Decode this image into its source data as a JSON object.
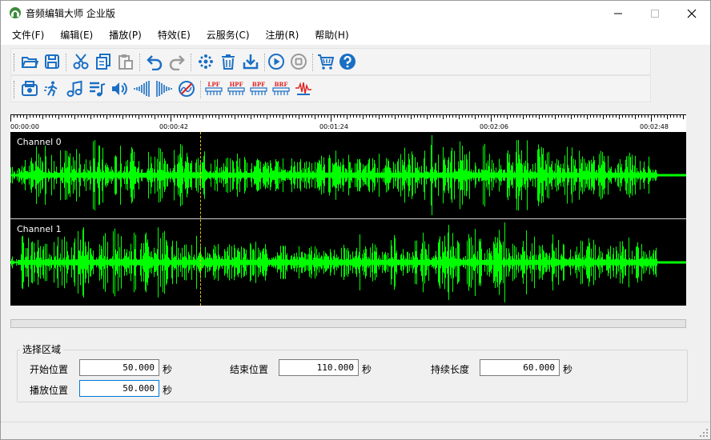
{
  "window": {
    "title": "音频编辑大师 企业版"
  },
  "menu": [
    "文件(F)",
    "编辑(E)",
    "播放(P)",
    "特效(E)",
    "云服务(C)",
    "注册(R)",
    "帮助(H)"
  ],
  "toolbar1": [
    "open-icon",
    "save-icon",
    "cut-icon",
    "copy-icon",
    "paste-icon",
    "undo-icon",
    "redo-icon",
    "effects-icon",
    "delete-icon",
    "download-icon",
    "play-icon",
    "stop-icon",
    "cart-icon",
    "help-icon"
  ],
  "toolbar2": [
    "stereo-icon",
    "walk-icon",
    "music-note-icon",
    "playlist-icon",
    "volume-icon",
    "fade-in-icon",
    "fade-out-icon",
    "mute-icon",
    "lpf-icon",
    "hpf-icon",
    "bpf-icon",
    "brf-icon",
    "waveform-icon"
  ],
  "filters": [
    "LPF",
    "HPF",
    "BPF",
    "BRF"
  ],
  "ruler": {
    "labels": [
      "00:00:00",
      "00:00:42",
      "00:01:24",
      "00:02:06",
      "00:02:48"
    ]
  },
  "channels": [
    {
      "label": "Channel 0"
    },
    {
      "label": "Channel 1"
    }
  ],
  "waveform": {
    "color": "#00ff00",
    "background": "#000000",
    "cursor_color": "#f0c000",
    "cursor_time": "00:00:50"
  },
  "selection": {
    "group_title": "选择区域",
    "start_label": "开始位置",
    "start_value": "50.000",
    "end_label": "结束位置",
    "end_value": "110.000",
    "duration_label": "持续长度",
    "duration_value": "60.000",
    "play_label": "播放位置",
    "play_value": "50.000",
    "unit": "秒"
  }
}
